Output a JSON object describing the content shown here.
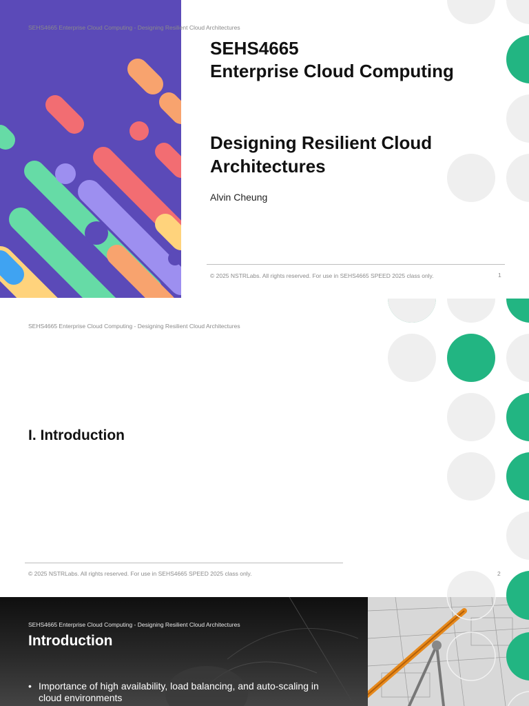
{
  "slides": [
    {
      "header": "SEHS4665 Enterprise Cloud Computing - Designing Resilient Cloud Architectures",
      "course_code": "SEHS4665",
      "course_name": "Enterprise Cloud Computing",
      "subtitle_line1": "Designing Resilient Cloud",
      "subtitle_line2": "Architectures",
      "author": "Alvin Cheung",
      "footer": "© 2025 NSTRLabs. All rights reserved. For use in SEHS4665 SPEED 2025 class only.",
      "page_number": "1"
    },
    {
      "header": "SEHS4665 Enterprise Cloud Computing - Designing Resilient Cloud Architectures",
      "section_title": "I. Introduction",
      "footer": "© 2025 NSTRLabs. All rights reserved. For use in SEHS4665 SPEED 2025 class only.",
      "page_number": "2"
    },
    {
      "header": "SEHS4665 Enterprise Cloud Computing - Designing Resilient Cloud Architectures",
      "title": "Introduction",
      "bullets": [
        "Importance of high availability, load balancing, and auto-scaling in cloud environments"
      ]
    }
  ],
  "colors": {
    "accent_green": "#22b582",
    "dot_grey": "#efefef",
    "art_background": "#5b4ab8",
    "art_coral": "#f26d72",
    "art_orange": "#f8a36e",
    "art_green": "#66dba6",
    "art_lavender": "#9d8ff0",
    "art_yellow": "#ffd37c",
    "art_blue": "#3fa3f2"
  },
  "icons": {
    "bullet": "bullet-dot-icon"
  }
}
